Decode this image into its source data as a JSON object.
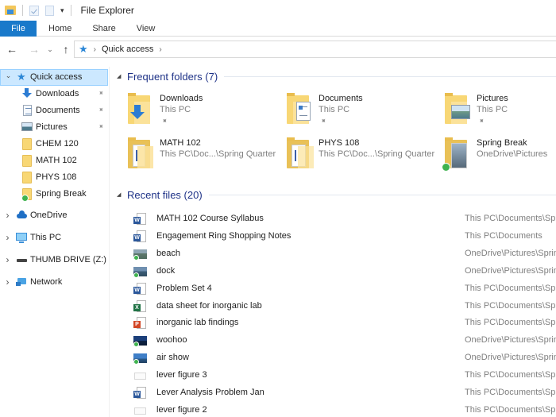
{
  "window": {
    "title": "File Explorer"
  },
  "ribbon": {
    "tabs": [
      {
        "label": "File",
        "active": true
      },
      {
        "label": "Home"
      },
      {
        "label": "Share"
      },
      {
        "label": "View"
      }
    ]
  },
  "navigation": {
    "back": "←",
    "forward": "→",
    "recent": "⌄",
    "up": "↑",
    "address": {
      "icon": "quick-access-star-icon",
      "segments": [
        "Quick access"
      ],
      "separator": "›"
    }
  },
  "sidebar": {
    "quick_access": {
      "label": "Quick access",
      "expanded": true,
      "selected": true,
      "items": [
        {
          "label": "Downloads",
          "icon": "downloads-icon",
          "pinned": true
        },
        {
          "label": "Documents",
          "icon": "documents-icon",
          "pinned": true
        },
        {
          "label": "Pictures",
          "icon": "pictures-icon",
          "pinned": true
        },
        {
          "label": "CHEM 120",
          "icon": "folder-icon",
          "pinned": false
        },
        {
          "label": "MATH 102",
          "icon": "folder-icon",
          "pinned": false
        },
        {
          "label": "PHYS 108",
          "icon": "folder-icon",
          "pinned": false
        },
        {
          "label": "Spring Break",
          "icon": "synced-folder-icon",
          "pinned": false
        }
      ]
    },
    "roots": [
      {
        "label": "OneDrive",
        "icon": "onedrive-icon"
      },
      {
        "label": "This PC",
        "icon": "this-pc-icon"
      },
      {
        "label": "THUMB DRIVE (Z:)",
        "icon": "usb-drive-icon"
      },
      {
        "label": "Network",
        "icon": "network-icon"
      }
    ],
    "pin_glyph": "📌",
    "expand_glyph": "›",
    "collapse_glyph": "⌄"
  },
  "frequent": {
    "title": "Frequent folders (7)",
    "folders": [
      {
        "name": "Downloads",
        "location": "This PC",
        "pinned": true,
        "icon": "downloads-folder-icon"
      },
      {
        "name": "Documents",
        "location": "This PC",
        "pinned": true,
        "icon": "documents-folder-icon"
      },
      {
        "name": "Pictures",
        "location": "This PC",
        "pinned": true,
        "icon": "pictures-folder-icon"
      },
      {
        "name": "MATH 102",
        "location": "This PC\\Doc...\\Spring Quarter",
        "pinned": false,
        "icon": "folder-icon"
      },
      {
        "name": "PHYS 108",
        "location": "This PC\\Doc...\\Spring Quarter",
        "pinned": false,
        "icon": "folder-icon"
      },
      {
        "name": "Spring Break",
        "location": "OneDrive\\Pictures",
        "pinned": false,
        "icon": "synced-folder-icon"
      }
    ]
  },
  "recent": {
    "title": "Recent files (20)",
    "files": [
      {
        "name": "MATH 102 Course Syllabus",
        "path": "This PC\\Documents\\Spri",
        "type": "word"
      },
      {
        "name": "Engagement Ring Shopping Notes",
        "path": "This PC\\Documents",
        "type": "word"
      },
      {
        "name": "beach",
        "path": "OneDrive\\Pictures\\Spring",
        "type": "photo"
      },
      {
        "name": "dock",
        "path": "OneDrive\\Pictures\\Spring",
        "type": "photo"
      },
      {
        "name": "Problem Set 4",
        "path": "This PC\\Documents\\Spri",
        "type": "word"
      },
      {
        "name": "data sheet for inorganic lab",
        "path": "This PC\\Documents\\Spri",
        "type": "excel"
      },
      {
        "name": "inorganic lab findings",
        "path": "This PC\\Documents\\Spri",
        "type": "powerpoint"
      },
      {
        "name": "woohoo",
        "path": "OneDrive\\Pictures\\Spring",
        "type": "photo"
      },
      {
        "name": "air show",
        "path": "OneDrive\\Pictures\\Spring",
        "type": "photo"
      },
      {
        "name": "lever figure 3",
        "path": "This PC\\Documents\\Spri",
        "type": "figure"
      },
      {
        "name": "Lever Analysis Problem Jan",
        "path": "This PC\\Documents\\Spri",
        "type": "word"
      },
      {
        "name": "lever figure 2",
        "path": "This PC\\Documents\\Spri",
        "type": "figure"
      }
    ]
  },
  "colors": {
    "accent": "#1979ca",
    "selection": "#cce8ff",
    "section_title": "#1e3287",
    "secondary_text": "#808080",
    "sync_ok": "#3fb34f"
  }
}
